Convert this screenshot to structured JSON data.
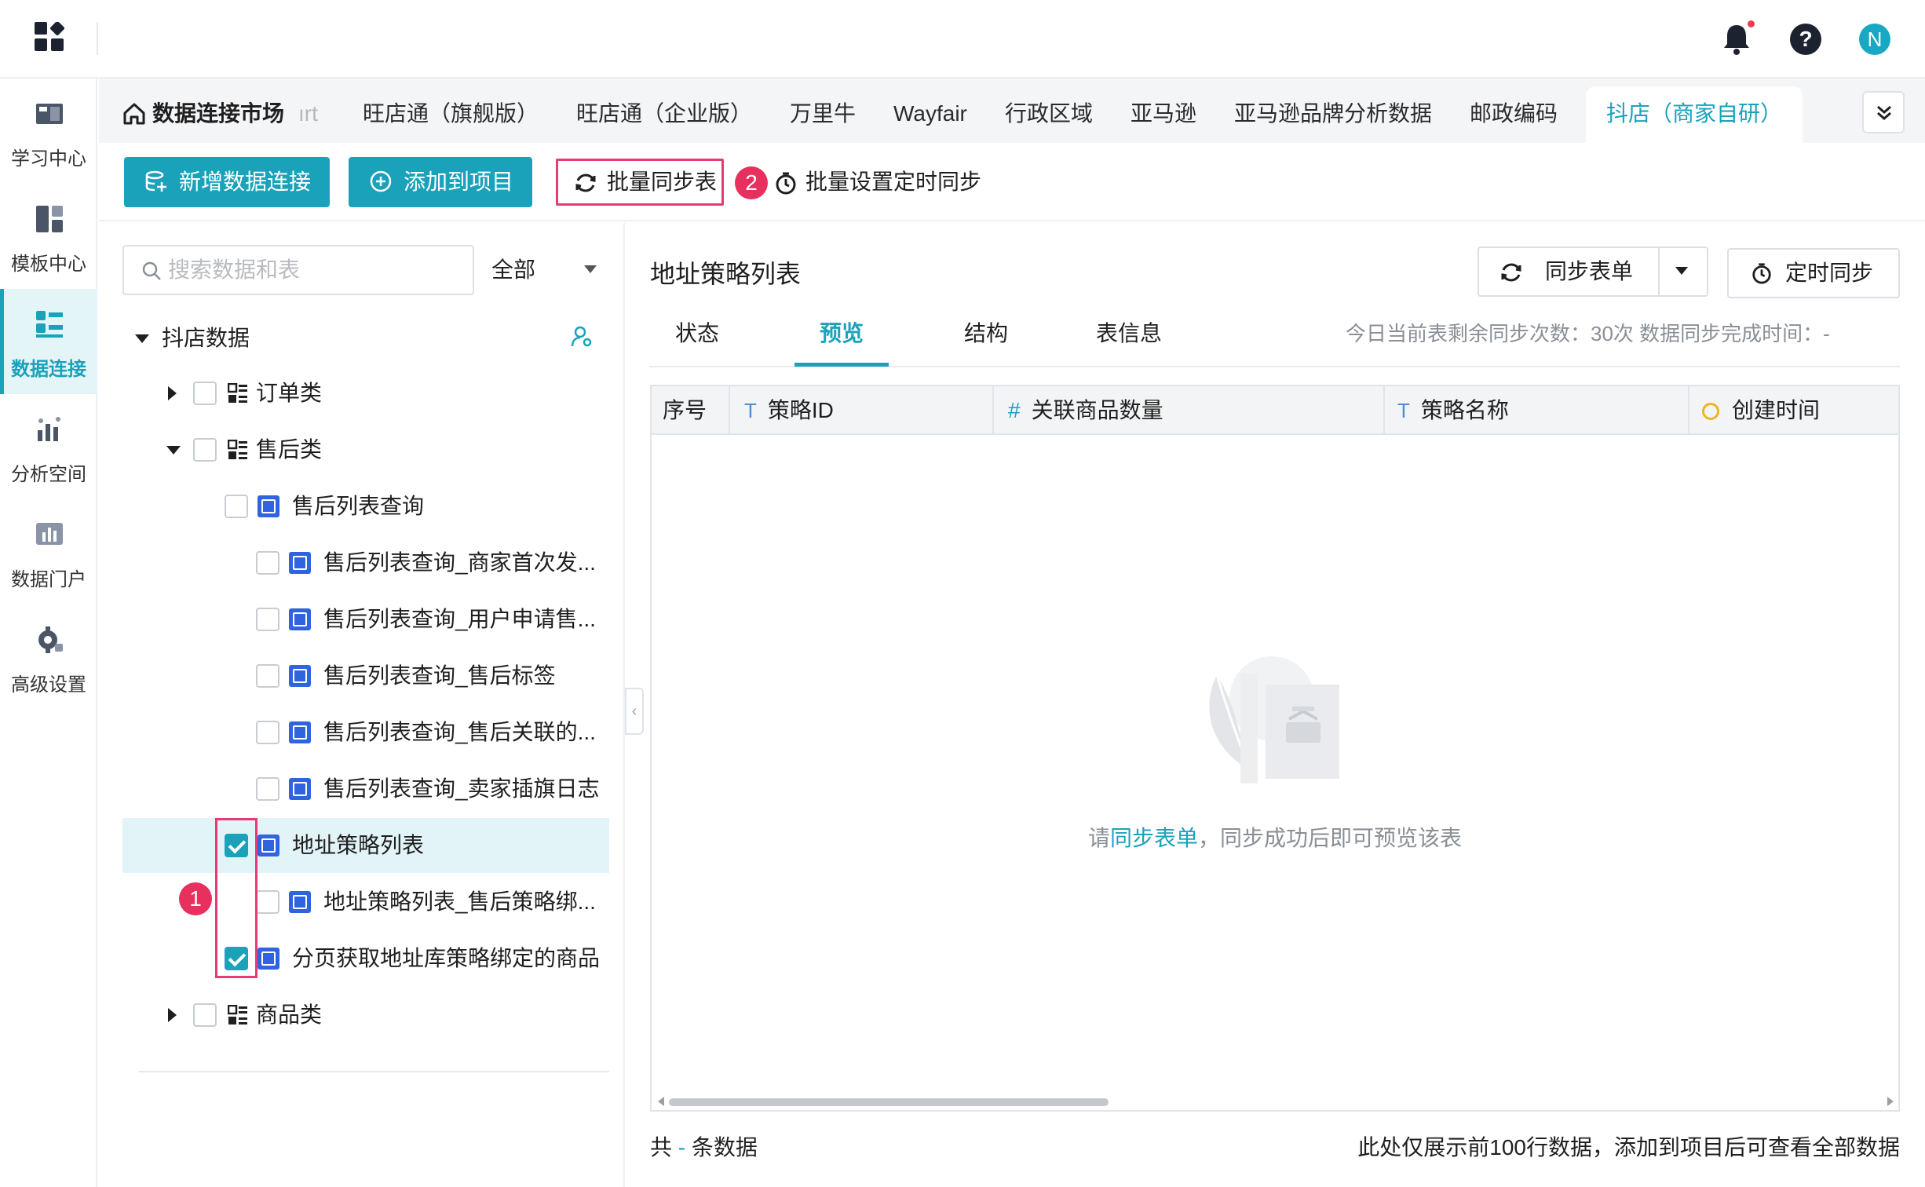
{
  "header": {
    "avatar_letter": "N"
  },
  "nav": [
    {
      "label": "学习中心",
      "icon": "learning-center-icon",
      "active": false
    },
    {
      "label": "模板中心",
      "icon": "template-center-icon",
      "active": false
    },
    {
      "label": "数据连接",
      "icon": "data-connection-icon",
      "active": true
    },
    {
      "label": "分析空间",
      "icon": "analysis-space-icon",
      "active": false
    },
    {
      "label": "数据门户",
      "icon": "data-portal-icon",
      "active": false
    },
    {
      "label": "高级设置",
      "icon": "advanced-settings-icon",
      "active": false
    }
  ],
  "tabs": {
    "market": "数据连接市场",
    "cut": "ırt",
    "items": [
      "旺店通（旗舰版）",
      "旺店通（企业版）",
      "万里牛",
      "Wayfair",
      "行政区域",
      "亚马逊",
      "亚马逊品牌分析数据",
      "邮政编码"
    ],
    "active": "抖店（商家自研）"
  },
  "toolbar": {
    "new_connection": "新增数据连接",
    "add_to_project": "添加到项目",
    "batch_sync": "批量同步表",
    "batch_timer": "批量设置定时同步",
    "badge_2": "2"
  },
  "tree": {
    "search_placeholder": "搜索数据和表",
    "filter": "全部",
    "root": "抖店数据",
    "orders": "订单类",
    "aftersale": "售后类",
    "aftersale_query": "售后列表查询",
    "children": [
      "售后列表查询_商家首次发...",
      "售后列表查询_用户申请售...",
      "售后列表查询_售后标签",
      "售后列表查询_售后关联的...",
      "售后列表查询_卖家插旗日志"
    ],
    "address_policy": "地址策略列表",
    "address_policy_child": "地址策略列表_售后策略绑...",
    "paged_products": "分页获取地址库策略绑定的商品",
    "products": "商品类",
    "badge_1": "1"
  },
  "detail": {
    "title": "地址策略列表",
    "sync_table": "同步表单",
    "timed_sync": "定时同步",
    "tabs": [
      "状态",
      "预览",
      "结构",
      "表信息"
    ],
    "sync_info": "今日当前表剩余同步次数：30次   数据同步完成时间：-",
    "columns": {
      "index": "序号",
      "policy_id": "策略ID",
      "product_count": "关联商品数量",
      "policy_name": "策略名称",
      "created_at": "创建时间"
    },
    "empty_prefix": "请",
    "empty_link": "同步表单",
    "empty_suffix": "，同步成功后即可预览该表",
    "footer_prefix": "共",
    "footer_dash": " - ",
    "footer_suffix": "条数据",
    "footer_note": "此处仅展示前100行数据，添加到项目后可查看全部数据"
  }
}
